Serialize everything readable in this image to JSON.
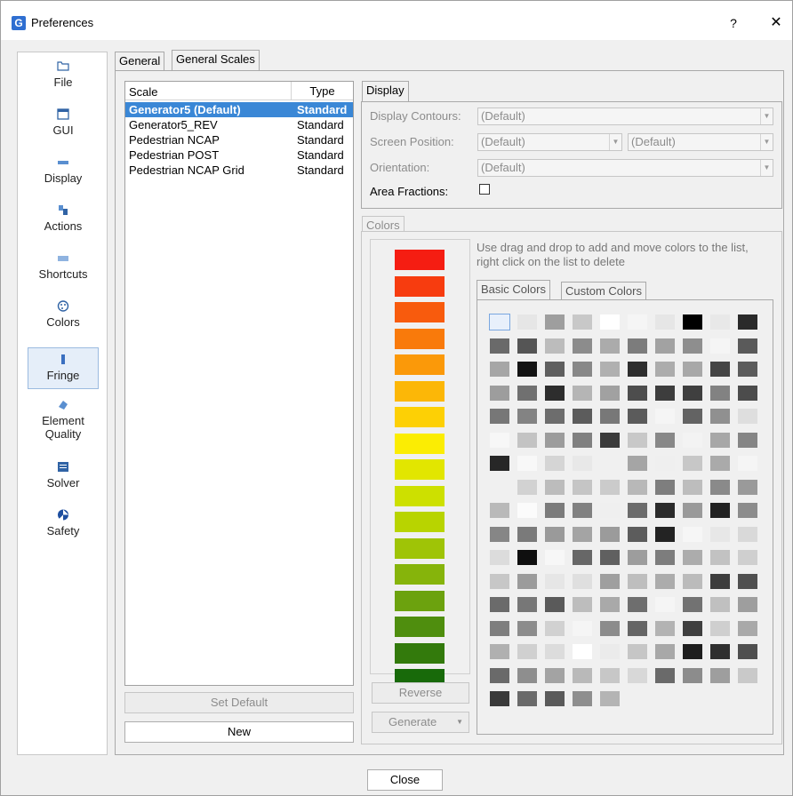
{
  "window": {
    "title": "Preferences",
    "help_label": "?",
    "close_symbol": "✕"
  },
  "sidebar": {
    "items": [
      {
        "label": "File",
        "icon": "folder-icon"
      },
      {
        "label": "GUI",
        "icon": "window-icon"
      },
      {
        "label": "Display",
        "icon": "display-icon"
      },
      {
        "label": "Actions",
        "icon": "actions-icon"
      },
      {
        "label": "Shortcuts",
        "icon": "keyboard-icon"
      },
      {
        "label": "Colors",
        "icon": "palette-icon"
      },
      {
        "label": "Fringe",
        "icon": "fringe-icon",
        "active": true
      },
      {
        "label": "Element Quality",
        "icon": "element-quality-icon"
      },
      {
        "label": "Solver",
        "icon": "solver-icon"
      },
      {
        "label": "Safety",
        "icon": "safety-icon"
      }
    ]
  },
  "tabs": {
    "general": "General",
    "general_scales": "General Scales"
  },
  "scale_list": {
    "header_scale": "Scale",
    "header_type": "Type",
    "rows": [
      {
        "scale": "Generator5 (Default)",
        "type": "Standard",
        "selected": true
      },
      {
        "scale": "Generator5_REV",
        "type": "Standard"
      },
      {
        "scale": "Pedestrian NCAP",
        "type": "Standard"
      },
      {
        "scale": "Pedestrian POST",
        "type": "Standard"
      },
      {
        "scale": "Pedestrian NCAP Grid",
        "type": "Standard"
      }
    ]
  },
  "buttons": {
    "set_default": "Set Default",
    "new": "New",
    "reverse": "Reverse",
    "generate": "Generate",
    "close": "Close"
  },
  "display": {
    "tab": "Display",
    "contours_label": "Display Contours:",
    "contours_value": "(Default)",
    "position_label": "Screen Position:",
    "position_value_1": "(Default)",
    "position_value_2": "(Default)",
    "orientation_label": "Orientation:",
    "orientation_value": "(Default)",
    "area_fractions_label": "Area Fractions:",
    "area_fractions_checked": false
  },
  "colors": {
    "tab": "Colors",
    "hint": "Use drag and drop to add and move colors to the list, right click on the list to delete",
    "basic_tab": "Basic Colors",
    "custom_tab": "Custom Colors",
    "scale_swatches": [
      "#f51d12",
      "#f73c0f",
      "#f85b0d",
      "#f97a0b",
      "#fb9909",
      "#fcb707",
      "#fdd005",
      "#fbed03",
      "#e2e600",
      "#cde000",
      "#b8d400",
      "#9fc406",
      "#86b40b",
      "#6ca20e",
      "#4f8e0e",
      "#337a0c",
      "#186a0a"
    ],
    "grid_rows": [
      [
        "#ffffff",
        "#e6e6e6",
        "#9e9e9e",
        "#c8c8c8",
        "#ffffff",
        "#f5f5f5",
        "#e6e6e6",
        "#000000",
        "#e8e8e8",
        "#2a2a2a"
      ],
      [
        "#6a6a6a",
        "#555555",
        "#bcbcbc",
        "#8c8c8c",
        "#ababab",
        "#7c7c7c",
        "#a2a2a2",
        "#8e8e8e",
        "#f5f5f5",
        "#5a5a5a"
      ],
      [
        "#a6a6a6",
        "#141414",
        "#5f5f5f",
        "#888888",
        "#b0b0b0",
        "#2e2e2e",
        "#acacac",
        "#a8a8a8",
        "#454545",
        "#5c5c5c"
      ],
      [
        "#9d9d9d",
        "#707070",
        "#2d2d2d",
        "#b5b5b5",
        "#a1a1a1",
        "#4d4d4d",
        "#3d3d3d",
        "#3f3f3f",
        "#828282",
        "#4c4c4c"
      ],
      [
        "#777777",
        "#838383",
        "#6d6d6d",
        "#5c5c5c",
        "#787878",
        "#5b5b5b",
        "#f5f5f5",
        "#636363",
        "#909090",
        "#dedede"
      ],
      [
        "#f7f7f7",
        "#c3c3c3",
        "#9c9c9c",
        "#808080",
        "#3b3b3b",
        "#c8c8c8",
        "#888888",
        "#f3f3f3",
        "#a7a7a7",
        "#858585"
      ],
      [
        "#272727",
        "#f8f8f8",
        "#d5d5d5",
        "#e8e8e8",
        "#f0f0f0",
        "#a5a5a5",
        "#efefef",
        "#c7c7c7",
        "#aaaaaa",
        "#f5f5f5"
      ],
      [
        "#f0f0f0",
        "#d2d2d2",
        "#bcbcbc",
        "#c5c5c5",
        "#cbcbcb",
        "#b8b8b8",
        "#7e7e7e",
        "#bdbdbd",
        "#8a8a8a",
        "#9a9a9a"
      ],
      [
        "#b9b9b9",
        "#fbfbfb",
        "#7b7b7b",
        "#818181",
        "#efefef",
        "#6b6b6b",
        "#2b2b2b",
        "#9a9a9a",
        "#222222",
        "#8c8c8c"
      ],
      [
        "#868686",
        "#7a7a7a",
        "#9a9a9a",
        "#a4a4a4",
        "#9b9b9b",
        "#5c5c5c",
        "#232323",
        "#f6f6f6",
        "#e7e7e7",
        "#d9d9d9"
      ],
      [
        "#dcdcdc",
        "#0f0f0f",
        "#f7f7f7",
        "#676767",
        "#606060",
        "#9d9d9d",
        "#7d7d7d",
        "#acacac",
        "#c2c2c2",
        "#cfcfcf"
      ],
      [
        "#c7c7c7",
        "#9b9b9b",
        "#e6e6e6",
        "#dfdfdf",
        "#9f9f9f",
        "#bebebe",
        "#acacac",
        "#bbbbbb",
        "#3d3d3d",
        "#505050"
      ],
      [
        "#6b6b6b",
        "#777777",
        "#5a5a5a",
        "#bdbdbd",
        "#a9a9a9",
        "#6e6e6e",
        "#f5f5f5",
        "#727272",
        "#c0c0c0",
        "#9e9e9e"
      ],
      [
        "#7e7e7e",
        "#8c8c8c",
        "#d1d1d1",
        "#f5f5f5",
        "#8c8c8c",
        "#656565",
        "#b3b3b3",
        "#3f3f3f",
        "#cfcfcf",
        "#a9a9a9"
      ],
      [
        "#b0b0b0",
        "#d0d0d0",
        "#dcdcdc",
        "#ffffff",
        "#ebebeb",
        "#c6c6c6",
        "#a8a8a8",
        "#1e1e1e",
        "#2f2f2f",
        "#4f4f4f"
      ],
      [
        "#6a6a6a",
        "#8e8e8e",
        "#a3a3a3",
        "#b9b9b9",
        "#c7c7c7",
        "#d8d8d8",
        "#6a6a6a",
        "#8c8c8c",
        "#9e9e9e",
        "#c9c9c9"
      ],
      [
        "#3a3a3a",
        "#6a6a6a",
        "#5a5a5a",
        "#8e8e8e",
        "#b4b4b4"
      ]
    ]
  }
}
